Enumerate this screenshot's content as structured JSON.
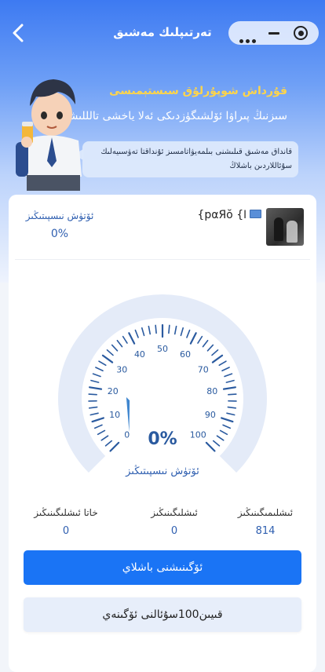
{
  "nav": {
    "title": "تەرتىپلىك مەشىق",
    "back_icon": "chevron-left-icon",
    "capsule_icons": [
      "more-dots-icon",
      "minimize-icon",
      "target-icon"
    ]
  },
  "hero": {
    "title": "قۇرداش شوپۇرلۇق سىستېمىسى",
    "subtitle": "سىزنىڭ پىراۋا ئۆلشىگۈزدىكى ئەلا ياخشى تالللىشىڭىز",
    "bubble_text": "قانداق مەشىق قىلىشنى بىلمەيۋاتامسىز ئۇنداقتا تەۋسىيەلىك سۇئاللاردىن باشلاڭ"
  },
  "user": {
    "name": "{pαЯŏ {ا",
    "progress_label": "ئۆتۈش نىسپىتىڭىز",
    "progress_value": "0%"
  },
  "gauge": {
    "value": 0,
    "max": 100,
    "display": "0%",
    "label": "ئۆتۈش نىسپىتىڭىز",
    "ticks": [
      "0",
      "10",
      "20",
      "30",
      "40",
      "50",
      "60",
      "70",
      "80",
      "90",
      "100"
    ]
  },
  "stats": [
    {
      "label": "ئىشلىمىگىنىڭىز",
      "value": "814"
    },
    {
      "label": "ئىشلىگىنىڭىز",
      "value": "0"
    },
    {
      "label": "خاتا ئىشلىگىنىڭىز",
      "value": "0"
    }
  ],
  "buttons": {
    "start": "ئۆگىنىشنى باشلاي",
    "random100": "قىيىن100سۇئالنى ئۆگىنەي"
  },
  "colors": {
    "primary": "#1a74f5",
    "accent_yellow": "#ffd54a",
    "gauge_blue": "#2f5fb0"
  }
}
